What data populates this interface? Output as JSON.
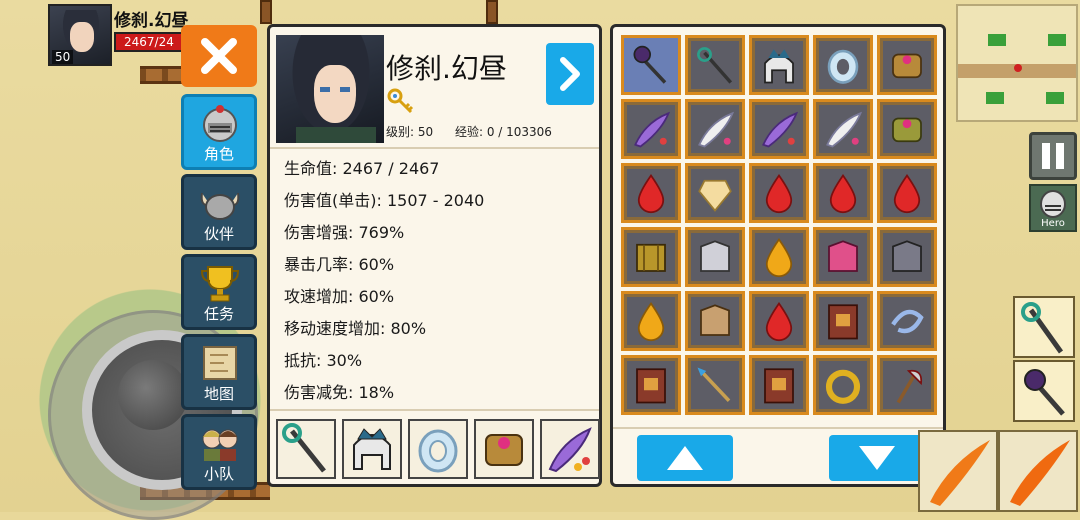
{
  "hud": {
    "hero_name": "修刹.幻昼",
    "hero_level": "50",
    "hero_hp": "2467/24",
    "hero_button_label": "Hero"
  },
  "menu": {
    "items": [
      {
        "label": "角色",
        "icon": "knight-helmet-icon",
        "active": true
      },
      {
        "label": "伙伴",
        "icon": "viking-helmet-icon",
        "active": false
      },
      {
        "label": "任务",
        "icon": "trophy-icon",
        "active": false
      },
      {
        "label": "地图",
        "icon": "scroll-map-icon",
        "active": false
      },
      {
        "label": "小队",
        "icon": "party-icon",
        "active": false
      }
    ]
  },
  "character": {
    "name": "修刹.幻昼",
    "level_label": "级别: 50",
    "exp_label": "经验: 0 / 103306",
    "stats": [
      "生命值: 2467 / 2467",
      "伤害值(单击): 1507 - 2040",
      "伤害增强: 769%",
      "暴击几率: 60%",
      "攻速增加: 60%",
      "移动速度增加: 80%",
      "抵抗: 30%",
      "伤害减免: 18%"
    ],
    "equipment": [
      "staff-icon",
      "crown-helmet-icon",
      "crystal-ring-icon",
      "gem-bracelet-icon",
      "feather-cloak-icon"
    ]
  },
  "inventory": {
    "rows": [
      [
        "dark-orb-staff-icon",
        "serpent-staff-icon",
        "crown-helmet-icon",
        "crystal-ring-icon",
        "gem-bracelet-icon"
      ],
      [
        "violet-feather-cloak-icon",
        "white-feather-cloak-icon",
        "violet-feather-cloak-icon",
        "white-feather-cloak-icon",
        "green-bracelet-icon"
      ],
      [
        "red-gem-icon",
        "topaz-gem-icon",
        "red-gem-icon",
        "red-gem-icon",
        "red-gem-icon"
      ],
      [
        "gold-armor-icon",
        "silver-armor-icon",
        "amber-gem-icon",
        "pink-armor-icon",
        "dark-armor-icon"
      ],
      [
        "amber-gem-icon",
        "bronze-armor-icon",
        "red-gem-icon",
        "spell-book-icon",
        "blue-ribbon-icon"
      ],
      [
        "spell-book-icon",
        "blue-spear-icon",
        "spell-book-icon",
        "gold-ring-icon",
        "axe-icon"
      ]
    ]
  },
  "colors": {
    "accent_blue": "#19a9e8",
    "close_orange": "#f07a18",
    "slot_border": "#d98a1e",
    "hp_red": "#cc1a1a"
  }
}
